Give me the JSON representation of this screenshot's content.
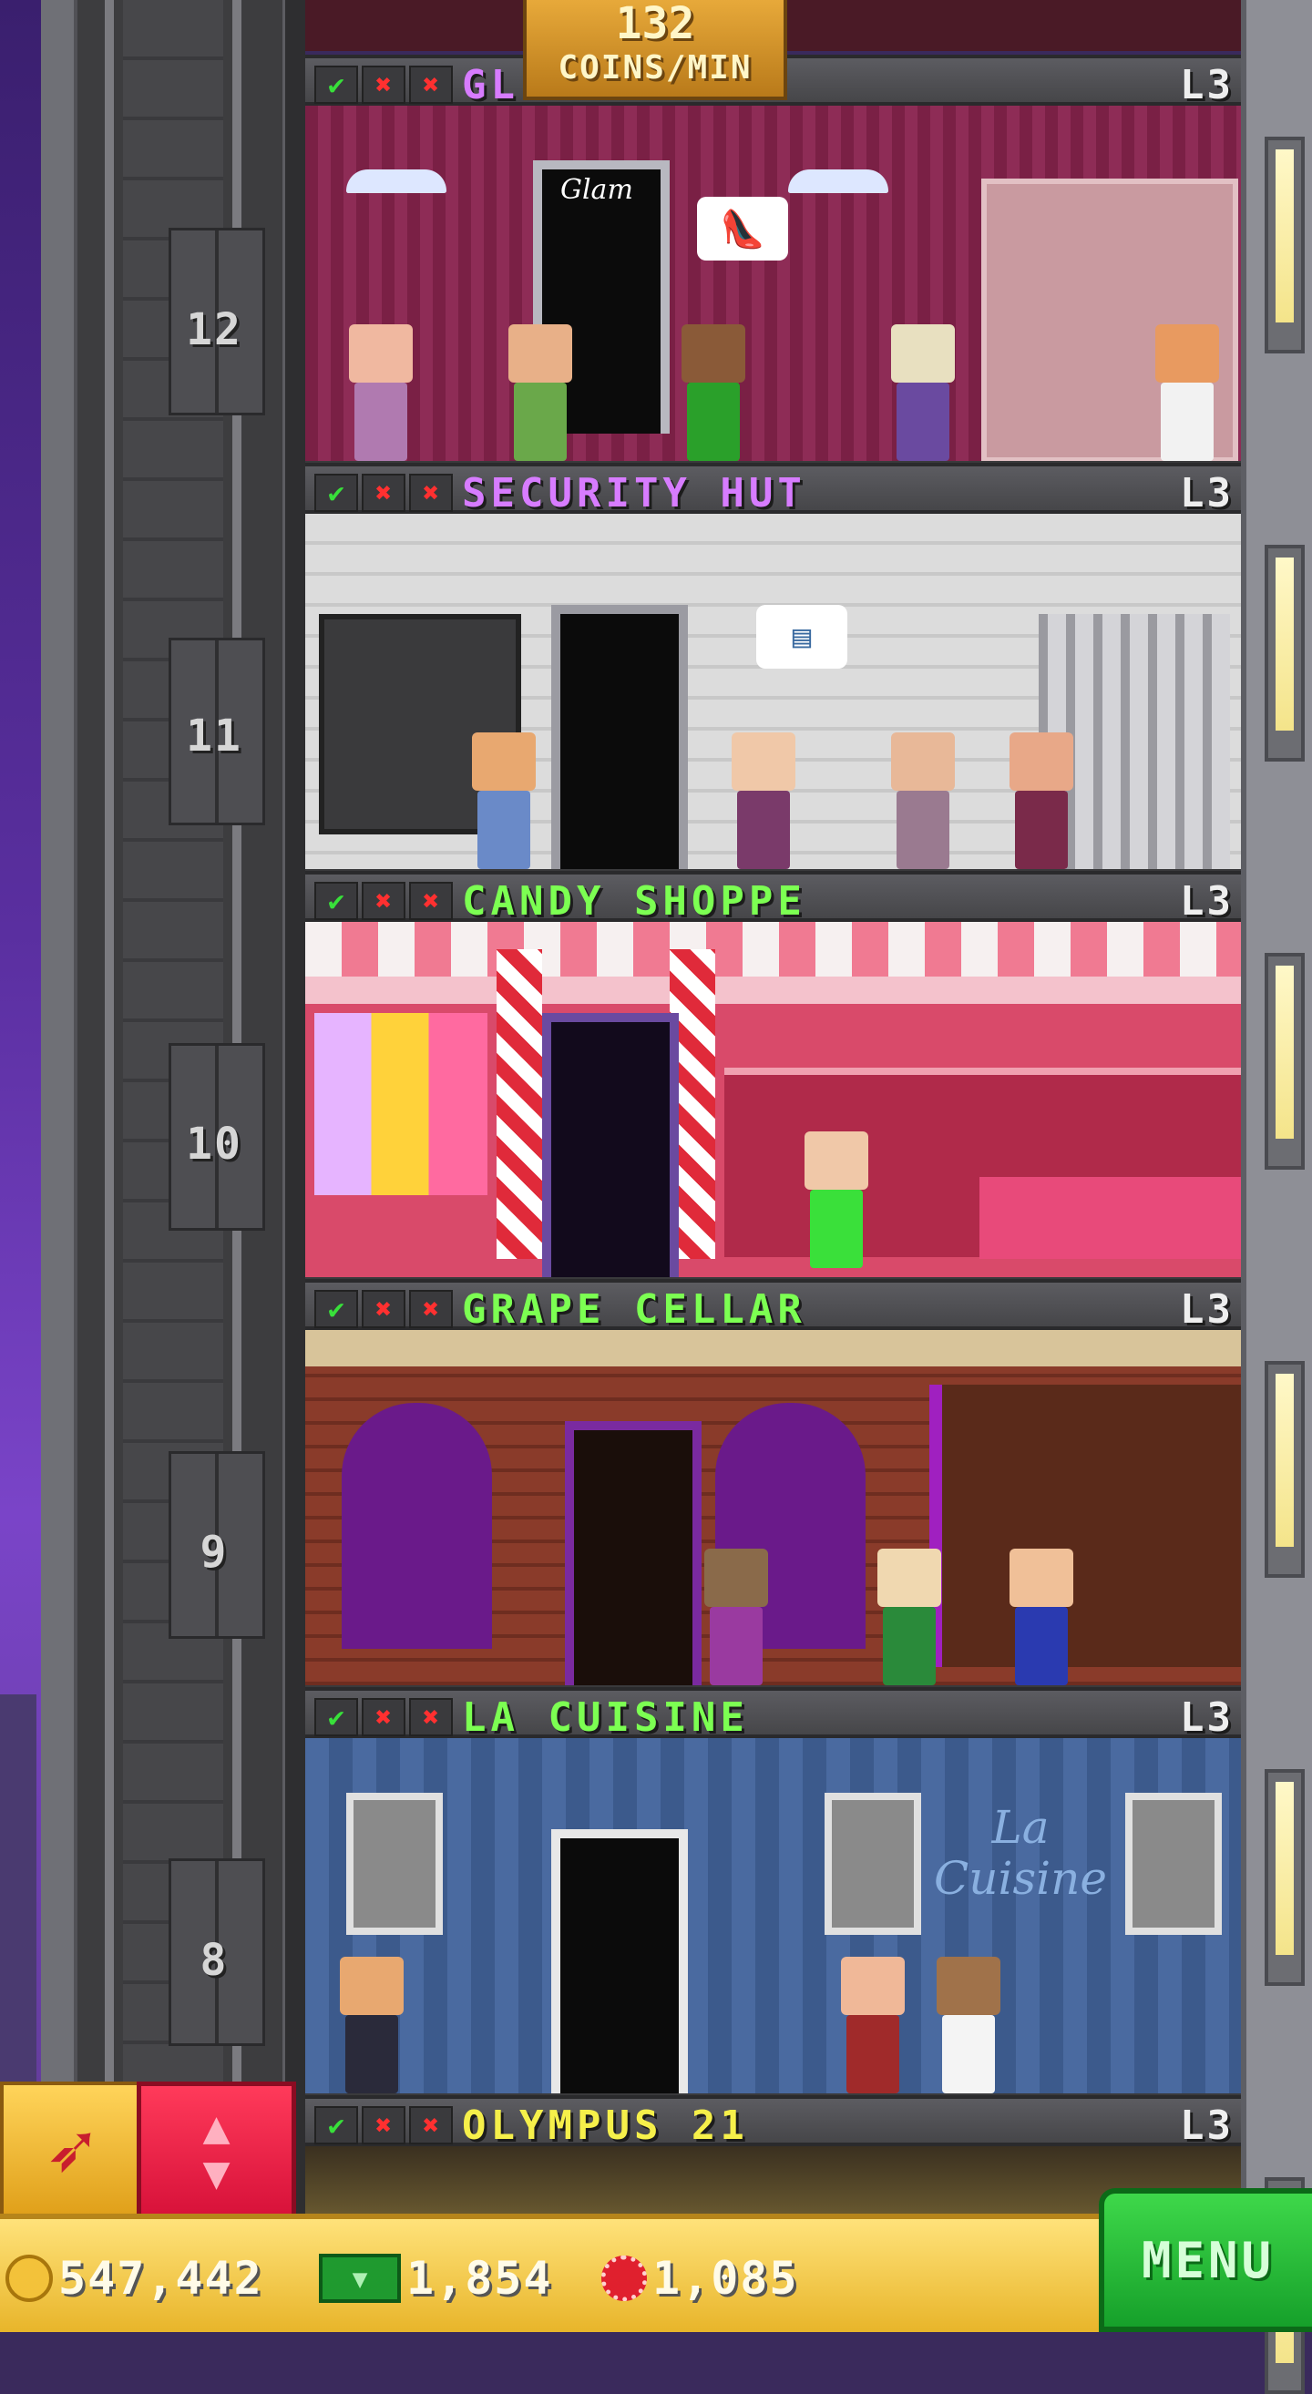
{
  "coin_rate": {
    "value": "132",
    "unit": "COINS/MIN"
  },
  "colors": {
    "check": "#38e03a",
    "cross": "#ff3030"
  },
  "shaft": {
    "floor_numbers": [
      "12",
      "11",
      "10",
      "9",
      "8"
    ]
  },
  "floors": [
    {
      "name": "GL",
      "level": "L3",
      "name_color": "#d77cff"
    },
    {
      "name": "SECURITY HUT",
      "level": "L3",
      "name_color": "#d77cff"
    },
    {
      "name": "CANDY SHOPPE",
      "level": "L3",
      "name_color": "#7cff52"
    },
    {
      "name": "GRAPE CELLAR",
      "level": "L3",
      "name_color": "#7cff52"
    },
    {
      "name": "LA CUISINE",
      "level": "L3",
      "name_color": "#7cff52"
    },
    {
      "name": "OLYMPUS 21",
      "level": "L3",
      "name_color": "#f6f04a"
    }
  ],
  "bottom": {
    "coins": "547,442",
    "bux": "1,854",
    "chips": "1,085",
    "menu": "MENU"
  },
  "icons": {
    "status": [
      "check-icon",
      "cross-icon",
      "cross-icon"
    ],
    "elevator": "elevator-up-down-icon",
    "raffle": "rocket-icon"
  },
  "room_signs": {
    "boutique": "Glam",
    "cuisine": "La Cuisine"
  }
}
